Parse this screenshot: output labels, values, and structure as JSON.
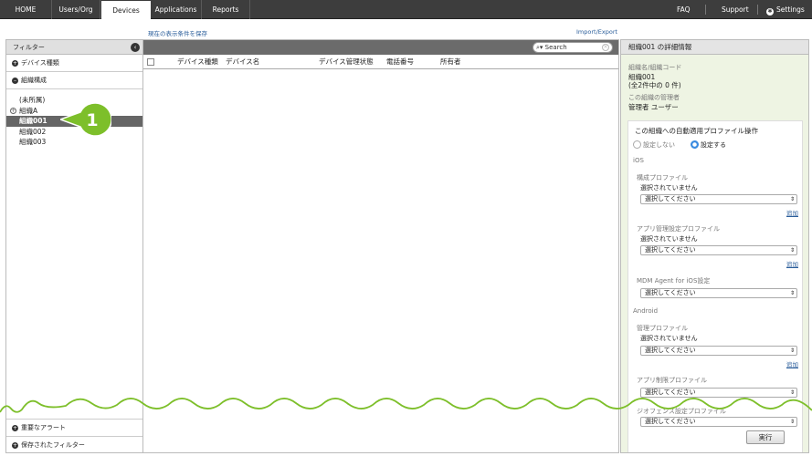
{
  "nav": {
    "tabs": [
      "HOME",
      "Users/Org",
      "Devices",
      "Applications",
      "Reports"
    ],
    "active_tab": "Devices",
    "faq": "FAQ",
    "support": "Support",
    "settings": "Settings"
  },
  "sublinks": {
    "save_view": "現在の表示条件を保存",
    "import_export": "Import/Export"
  },
  "filter": {
    "title": "フィルター",
    "device_type": "デバイス種類",
    "org_structure": "組織構成",
    "tree": [
      "(未所属)",
      "組織A",
      "組織001",
      "組織002",
      "組織003"
    ],
    "selected": "組織001",
    "important_alert": "重要なアラート",
    "saved_filter": "保存されたフィルター"
  },
  "callout": {
    "number": "1"
  },
  "device_list": {
    "search_placeholder": "Search",
    "columns": [
      "デバイス種類",
      "デバイス名",
      "デバイス管理状態",
      "電話番号",
      "所有者"
    ]
  },
  "detail": {
    "title": "組織001 の詳細情報",
    "name_code_label": "組織名/組織コード",
    "name_code_value": "組織001",
    "count_text": "(全2件中の 0 件)",
    "admin_label": "この組織の管理者",
    "admin_value": "管理者 ユーザー",
    "auto_profile_title": "この組織への自動適用プロファイル操作",
    "radio_off": "設定しない",
    "radio_on": "設定する",
    "ios_label": "iOS",
    "config_profile_label": "構成プロファイル",
    "app_mgmt_profile_label": "アプリ管理設定プロファイル",
    "mdm_agent_label": "MDM Agent for iOS設定",
    "android_label": "Android",
    "mgmt_profile_label": "管理プロファイル",
    "app_restrict_profile_label": "アプリ制限プロファイル",
    "geofence_profile_label": "ジオフェンス設定プロファイル",
    "none_selected": "選択されていません",
    "select_placeholder": "選択してください",
    "add_link": "追加",
    "run_button": "実行"
  },
  "colors": {
    "nav_bg": "#3d3d3d",
    "accent_green": "#7dbf2a",
    "detail_bg": "#eef4e3",
    "link_blue": "#2a5d9a"
  }
}
